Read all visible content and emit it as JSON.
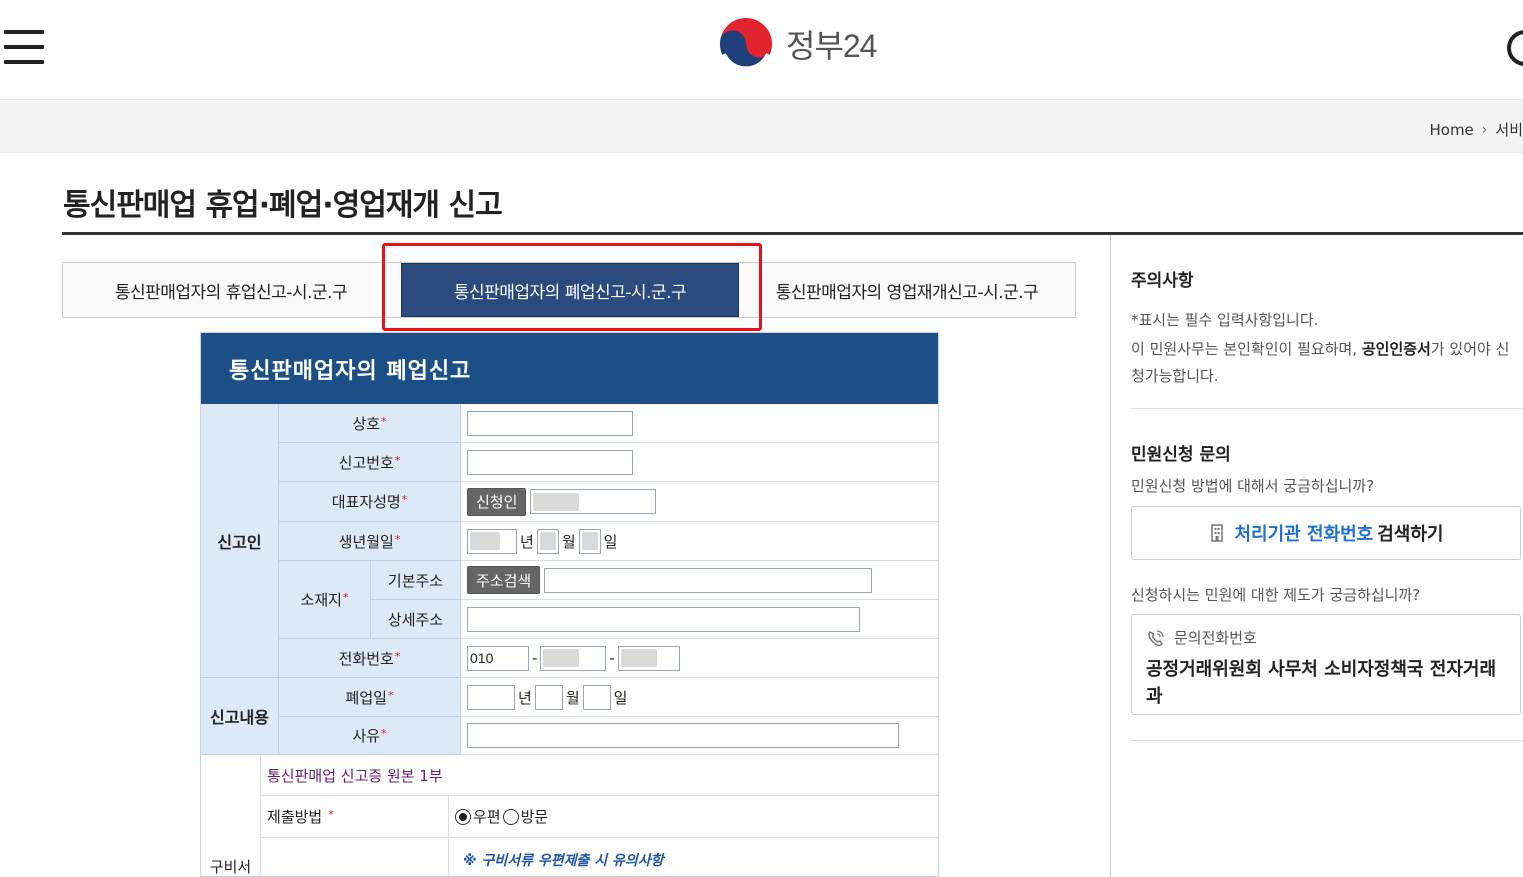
{
  "header": {
    "logo_text": "정부24"
  },
  "breadcrumb": {
    "home": "Home",
    "next": "서비"
  },
  "page_title": "통신판매업 휴업·폐업·영업재개 신고",
  "tabs": [
    {
      "label": "통신판매업자의 휴업신고-시.군.구"
    },
    {
      "label": "통신판매업자의 폐업신고-시.군.구"
    },
    {
      "label": "통신판매업자의 영업재개신고-시.군.구"
    }
  ],
  "form": {
    "heading": "통신판매업자의 폐업신고",
    "req_mark": "*",
    "groups": {
      "reporter": "신고인",
      "content": "신고내용",
      "docs": "구비서"
    },
    "labels": {
      "trade_name": "상호",
      "report_no": "신고번호",
      "rep_name": "대표자성명",
      "birth": "생년월일",
      "location": "소재지",
      "basic_addr": "기본주소",
      "detail_addr": "상세주소",
      "phone": "전화번호",
      "close_date": "폐업일",
      "reason": "사유"
    },
    "applicant_btn": "신청인",
    "address_btn": "주소검색",
    "units": {
      "year": "년",
      "month": "월",
      "day": "일"
    },
    "phone_prefix": "010",
    "phone_sep": "-",
    "doc_line": "통신판매업 신고증 원본 1부",
    "submit_method_label": "제출방법",
    "submit_options": [
      "우편",
      "방문"
    ],
    "notice_title": "※ 구비서류 우편제출 시 유의사항"
  },
  "sidebar": {
    "caution_title": "주의사항",
    "caution_required": "*표시는 필수 입력사항입니다.",
    "caution_cert_a": "이 민원사무는 본인확인이 필요하며, ",
    "caution_cert_b": "공인인증서",
    "caution_cert_c": "가 있어야 신청가능합니다.",
    "inquiry_title": "민원신청 문의",
    "inquiry_question": "민원신청 방법에 대해서 궁금하십니까?",
    "search_btn_blue": "처리기관 전화번호",
    "search_btn_rest": "검색하기",
    "system_question": "신청하시는 민원에 대한 제도가 궁금하십니까?",
    "contact_label": "문의전화번호",
    "contact_org": "공정거래위원회 사무처 소비자정책국 전자거래과"
  },
  "colors": {
    "tab_active": "#2b4a7e",
    "form_header": "#1c4f85",
    "label_bg": "#dde9f6",
    "highlight": "#e4141a",
    "link_blue": "#1d6fd0"
  }
}
